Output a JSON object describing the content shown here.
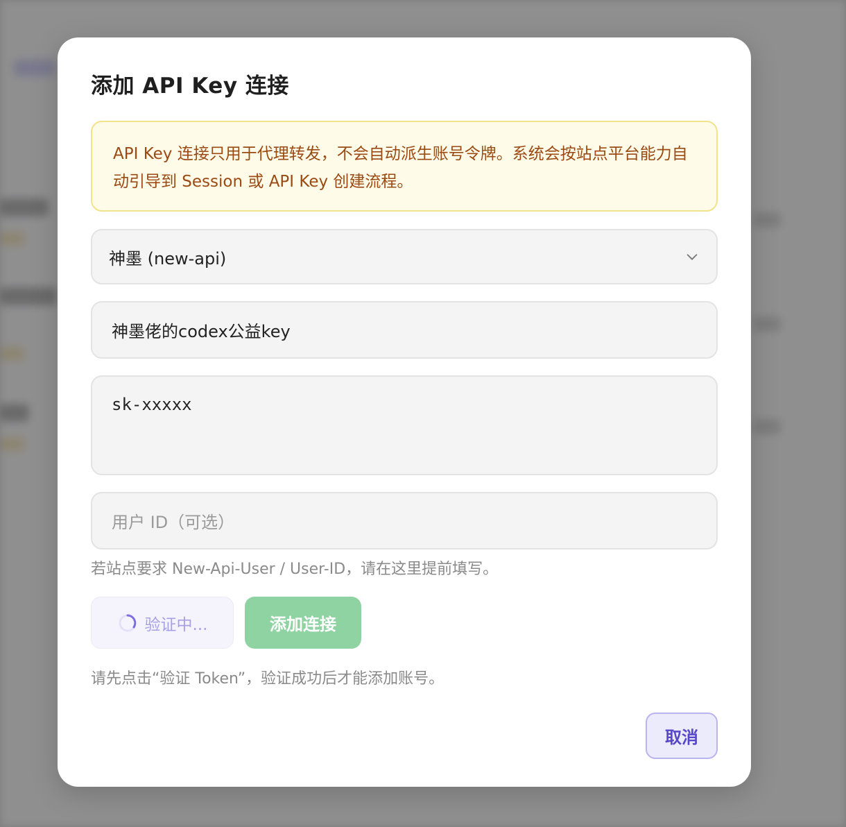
{
  "dialog": {
    "title": "添加 API Key 连接",
    "notice": "API Key 连接只用于代理转发，不会自动派生账号令牌。系统会按站点平台能力自动引导到 Session 或 API Key 创建流程。",
    "site_select": {
      "value": "神墨 (new-api)",
      "icon": "chevron-down-icon"
    },
    "name_input": {
      "value": "神墨佬的codex公益key"
    },
    "key_textarea": {
      "value": "sk-xxxxx"
    },
    "user_id_input": {
      "placeholder": "用户 ID（可选）"
    },
    "user_id_hint": "若站点要求 New-Api-User / User-ID，请在这里提前填写。",
    "verify_button": {
      "label": "验证中...",
      "icon": "spinner-icon"
    },
    "add_button": {
      "label": "添加连接"
    },
    "verify_hint": "请先点击“验证 Token”，验证成功后才能添加账号。",
    "cancel_button": {
      "label": "取消"
    }
  },
  "colors": {
    "notice_bg": "#fefbe8",
    "notice_border": "#f2e28a",
    "notice_text": "#9a4a12",
    "add_button": "#8fd3a3",
    "verify_text": "#a89fe6",
    "cancel_text": "#5646c8",
    "cancel_border": "#b9b3ee"
  }
}
